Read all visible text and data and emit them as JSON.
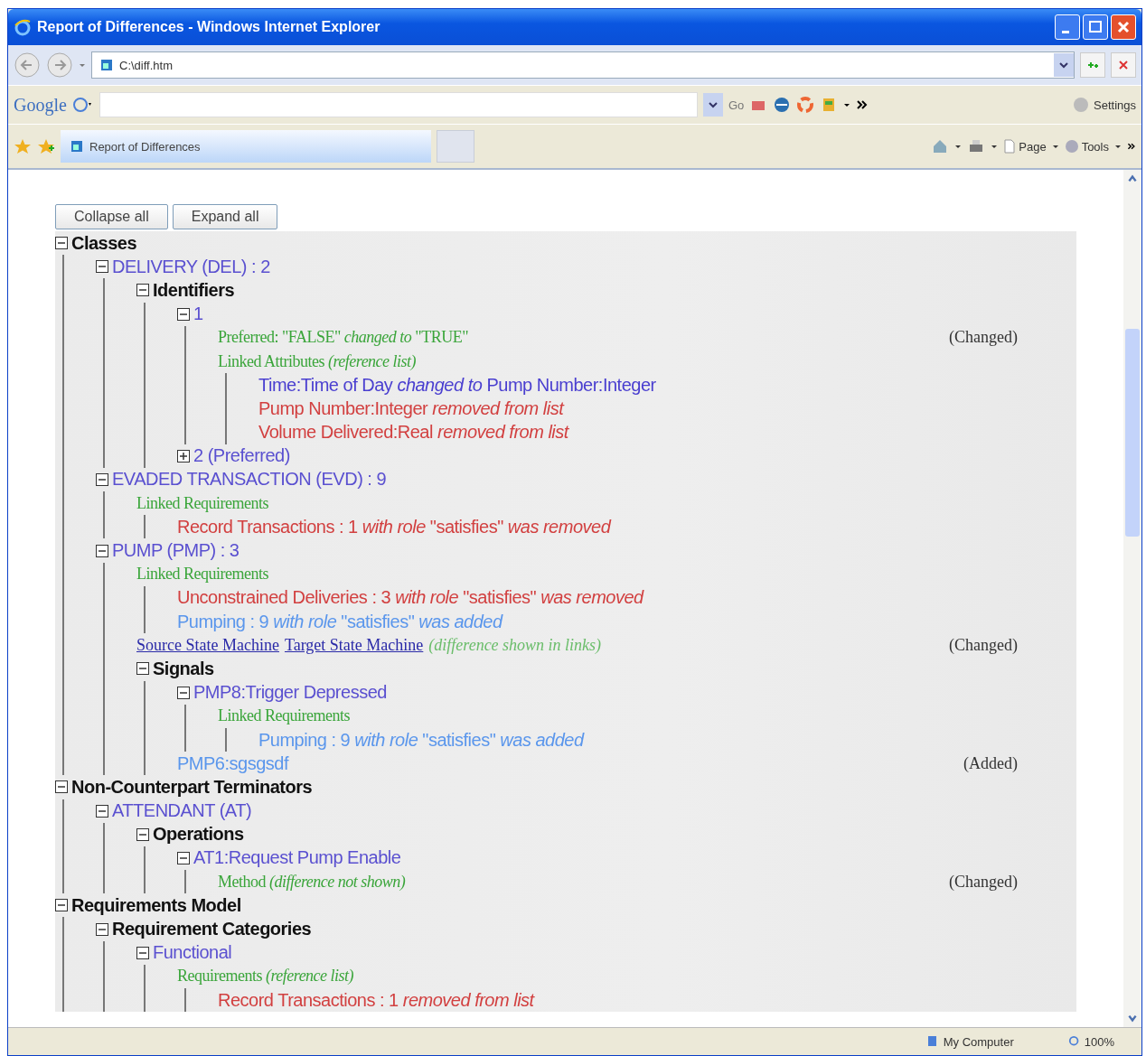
{
  "window": {
    "title": "Report of Differences - Windows Internet Explorer"
  },
  "address_bar": {
    "value": "C:\\diff.htm"
  },
  "google_toolbar": {
    "logo": "Google",
    "search_button": "Go",
    "settings": "Settings"
  },
  "tab": {
    "label": "Report of Differences",
    "selected": true
  },
  "command_bar": {
    "page": "Page",
    "tools": "Tools"
  },
  "buttons": [
    "Collapse all",
    "Expand all"
  ],
  "tree": [
    {
      "kind": "section",
      "text": "Classes",
      "expanded": true,
      "children": [
        {
          "kind": "element",
          "text": "DELIVERY (DEL) : 2",
          "expanded": true,
          "children": [
            {
              "kind": "section",
              "text": "Identifiers",
              "expanded": true,
              "children": [
                {
                  "kind": "element",
                  "text": "1",
                  "expanded": true,
                  "children": [
                    {
                      "kind": "property",
                      "text": "Preferred: \"FALSE\" *changed to* \"TRUE\"",
                      "status": "(Changed)"
                    },
                    {
                      "kind": "property",
                      "text": "Linked Attributes *(reference list)*",
                      "children": [
                        {
                          "kind": "changed",
                          "text": "Time:Time of Day *changed to* Pump Number:Integer"
                        },
                        {
                          "kind": "removed",
                          "text": "Pump Number:Integer *removed from list*"
                        },
                        {
                          "kind": "removed",
                          "text": "Volume Delivered:Real *removed from list*"
                        }
                      ]
                    }
                  ]
                },
                {
                  "kind": "element",
                  "text": "2 (Preferred)",
                  "expanded": false
                }
              ]
            }
          ]
        },
        {
          "kind": "element",
          "text": "EVADED TRANSACTION (EVD) : 9",
          "expanded": true,
          "children": [
            {
              "kind": "property",
              "text": "Linked Requirements",
              "children": [
                {
                  "kind": "removed",
                  "text": "Record Transactions : 1 *with role* \"satisfies\" *was removed*"
                }
              ]
            }
          ]
        },
        {
          "kind": "element",
          "text": "PUMP (PMP) : 3",
          "expanded": true,
          "children": [
            {
              "kind": "property",
              "text": "Linked Requirements",
              "children": [
                {
                  "kind": "removed",
                  "text": "Unconstrained Deliveries : 3 *with role* \"satisfies\" *was removed*"
                },
                {
                  "kind": "added",
                  "text": "Pumping : 9 *with role* \"satisfies\" *was added*"
                }
              ]
            },
            {
              "kind": "links",
              "links": [
                "Source State Machine",
                "Target State Machine"
              ],
              "text": "(difference shown in links)",
              "status": "(Changed)"
            },
            {
              "kind": "section",
              "text": "Signals",
              "expanded": true,
              "children": [
                {
                  "kind": "element",
                  "text": "PMP8:Trigger Depressed",
                  "expanded": true,
                  "children": [
                    {
                      "kind": "property",
                      "text": "Linked Requirements",
                      "children": [
                        {
                          "kind": "added",
                          "text": "Pumping : 9 *with role* \"satisfies\" *was added*"
                        }
                      ]
                    }
                  ]
                },
                {
                  "kind": "added",
                  "text": "PMP6:sgsgsdf",
                  "status": "(Added)"
                }
              ]
            }
          ]
        }
      ]
    },
    {
      "kind": "section",
      "text": "Non-Counterpart Terminators",
      "expanded": true,
      "children": [
        {
          "kind": "element",
          "text": "ATTENDANT (AT)",
          "expanded": true,
          "children": [
            {
              "kind": "section",
              "text": "Operations",
              "expanded": true,
              "children": [
                {
                  "kind": "element",
                  "text": "AT1:Request Pump Enable",
                  "expanded": true,
                  "children": [
                    {
                      "kind": "property",
                      "text": "Method *(difference not shown)*",
                      "status": "(Changed)"
                    }
                  ]
                }
              ]
            }
          ]
        }
      ]
    },
    {
      "kind": "section",
      "text": "Requirements Model",
      "expanded": true,
      "children": [
        {
          "kind": "section",
          "text": "Requirement Categories",
          "expanded": true,
          "children": [
            {
              "kind": "element",
              "text": "Functional",
              "expanded": true,
              "children": [
                {
                  "kind": "property",
                  "text": "Requirements *(reference list)*",
                  "children": [
                    {
                      "kind": "removed",
                      "text": "Record Transactions : 1 *removed from list*"
                    }
                  ]
                }
              ]
            }
          ]
        }
      ]
    }
  ],
  "status_bar": {
    "zone": "My Computer",
    "zoom": "100%"
  }
}
